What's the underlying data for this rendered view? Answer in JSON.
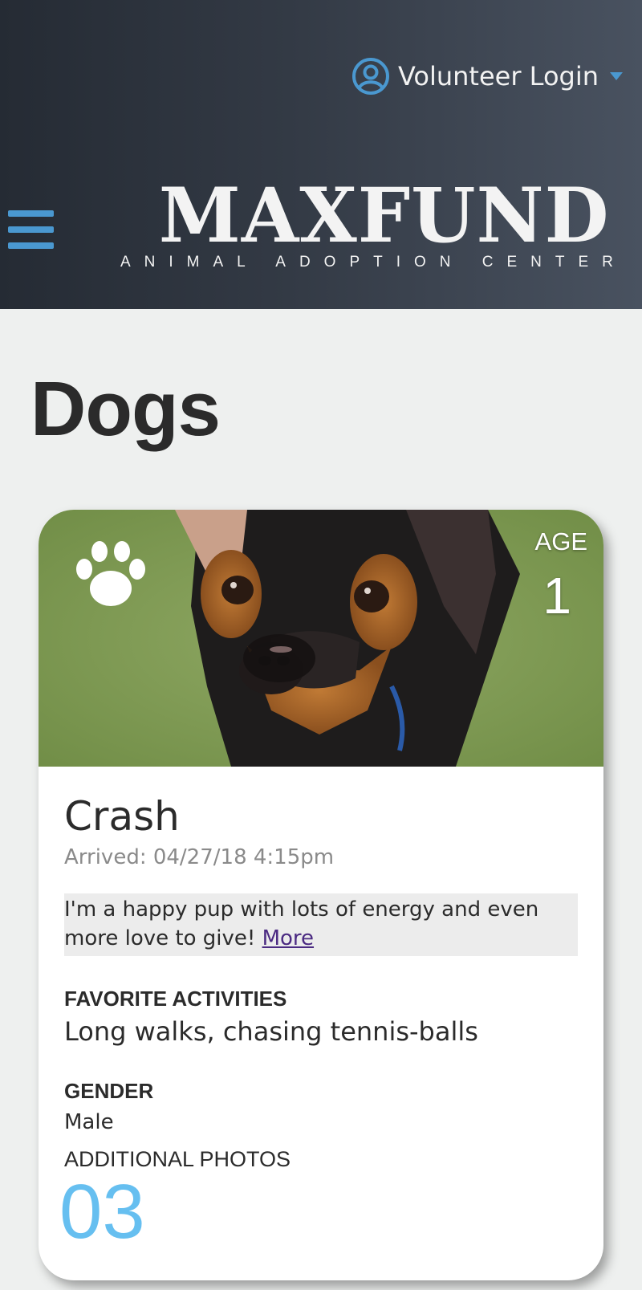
{
  "header": {
    "login_label": "Volunteer Login",
    "logo_word": "MAXFUND",
    "logo_tagline": "ANIMAL ADOPTION CENTER",
    "user_icon": "user-circle-icon",
    "caret_icon": "caret-down-icon",
    "menu_icon": "hamburger-menu-icon",
    "accent_color": "#4a98d0"
  },
  "page": {
    "title": "Dogs"
  },
  "card": {
    "age_label": "AGE",
    "age_value": "1",
    "name": "Crash",
    "arrived": "Arrived: 04/27/18 4:15pm",
    "description": "I'm a happy pup with lots of energy and even more love to give!",
    "more_link": "More",
    "favorite_label": "FAVORITE ACTIVITIES",
    "favorite_value": "Long walks, chasing tennis-balls",
    "gender_label": "GENDER",
    "gender_value": "Male",
    "photos_label": "ADDITIONAL PHOTOS",
    "photos_count": "03",
    "photos_color": "#66bff0",
    "paw_icon": "paw-icon"
  }
}
